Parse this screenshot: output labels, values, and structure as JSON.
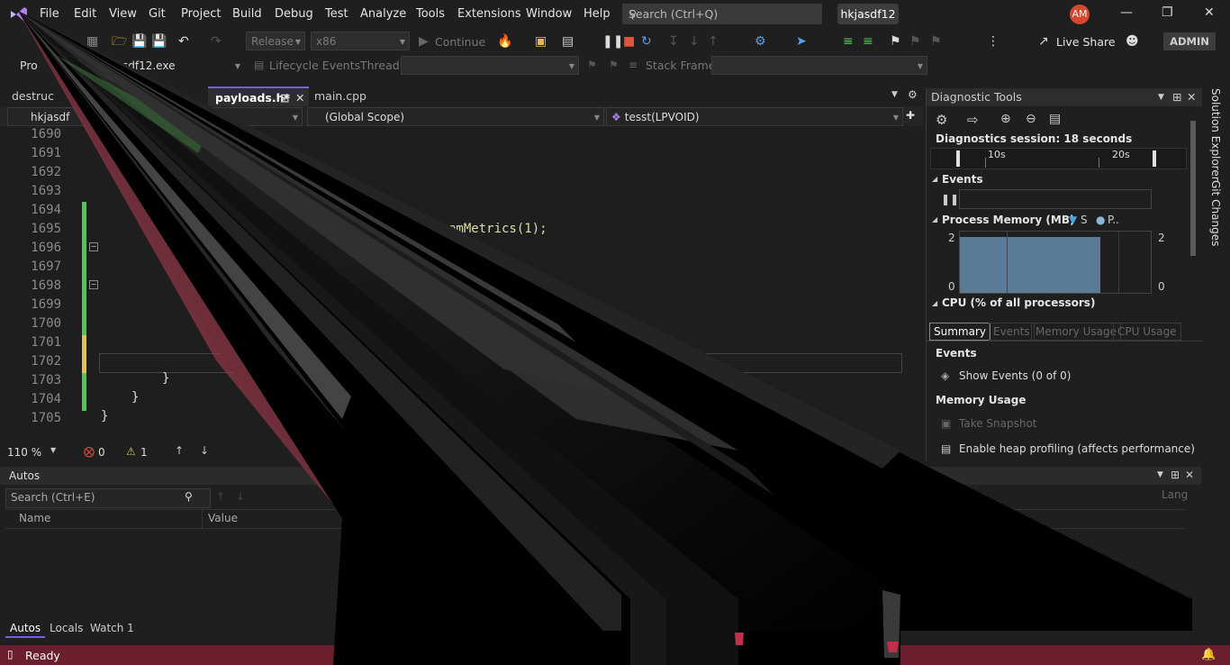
{
  "menu": {
    "items": [
      "File",
      "Edit",
      "View",
      "Git",
      "Project",
      "Build",
      "Debug",
      "Test",
      "Analyze",
      "Tools",
      "Extensions",
      "Window",
      "Help"
    ],
    "search_placeholder": "Search (Ctrl+Q)",
    "solution_name": "hkjasdf12",
    "avatar_initials": "AM"
  },
  "toolbar": {
    "config": "Release",
    "platform": "x86",
    "continue_label": "Continue",
    "live_share": "Live Share",
    "admin": "ADMIN"
  },
  "debug_location": {
    "process_prefix": "Pro",
    "process_value": "sdf12.exe",
    "lifecycle_label": "Lifecycle Events",
    "thread_label": "Thread:",
    "stack_frame_label": "Stack Frame:"
  },
  "editor": {
    "tabs": [
      {
        "label": "destruc"
      },
      {
        "label": "payloads.h*"
      },
      {
        "label": "main.cpp"
      }
    ],
    "nav": {
      "project": "hkjasdf",
      "scope": "(Global Scope)",
      "function": "tesst(LPVOID)"
    },
    "line_numbers": [
      "1690",
      "1691",
      "1692",
      "1693",
      "1694",
      "1695",
      "1696",
      "1697",
      "1698",
      "1699",
      "1700",
      "1701",
      "1702",
      "1703",
      "1704",
      "1705"
    ],
    "code_fragment": "emMetrics(1);",
    "brace_1703": "}",
    "brace_1704": "}",
    "brace_1705": "}",
    "zoom": "110 %",
    "errors": "0",
    "warnings": "1"
  },
  "diagnostics": {
    "title": "Diagnostic Tools",
    "session": "Diagnostics session: 18 seconds",
    "tick_10s": "10s",
    "tick_20s": "20s",
    "events_header": "Events",
    "memory_header": "Process Memory (MB)",
    "memory_legend_s": "S",
    "memory_legend_p": "P..",
    "memory_max_left": "2",
    "memory_min_left": "0",
    "memory_max_right": "2",
    "memory_min_right": "0",
    "cpu_header": "CPU (% of all processors)",
    "tabs": [
      "Summary",
      "Events",
      "Memory Usage",
      "CPU Usage"
    ],
    "summary_events": "Events",
    "show_events": "Show Events (0 of 0)",
    "memory_usage": "Memory Usage",
    "take_snapshot": "Take Snapshot",
    "heap_profiling": "Enable heap profiling (affects performance)"
  },
  "autos": {
    "title": "Autos",
    "search_placeholder": "Search (Ctrl+E)",
    "col_name": "Name",
    "col_value": "Value",
    "col_lang": "Lang",
    "tabs": [
      "Autos",
      "Locals",
      "Watch 1"
    ]
  },
  "sidebar": {
    "solution_explorer": "Solution Explorer",
    "git_changes": "Git Changes"
  },
  "status": {
    "text": "Ready"
  }
}
